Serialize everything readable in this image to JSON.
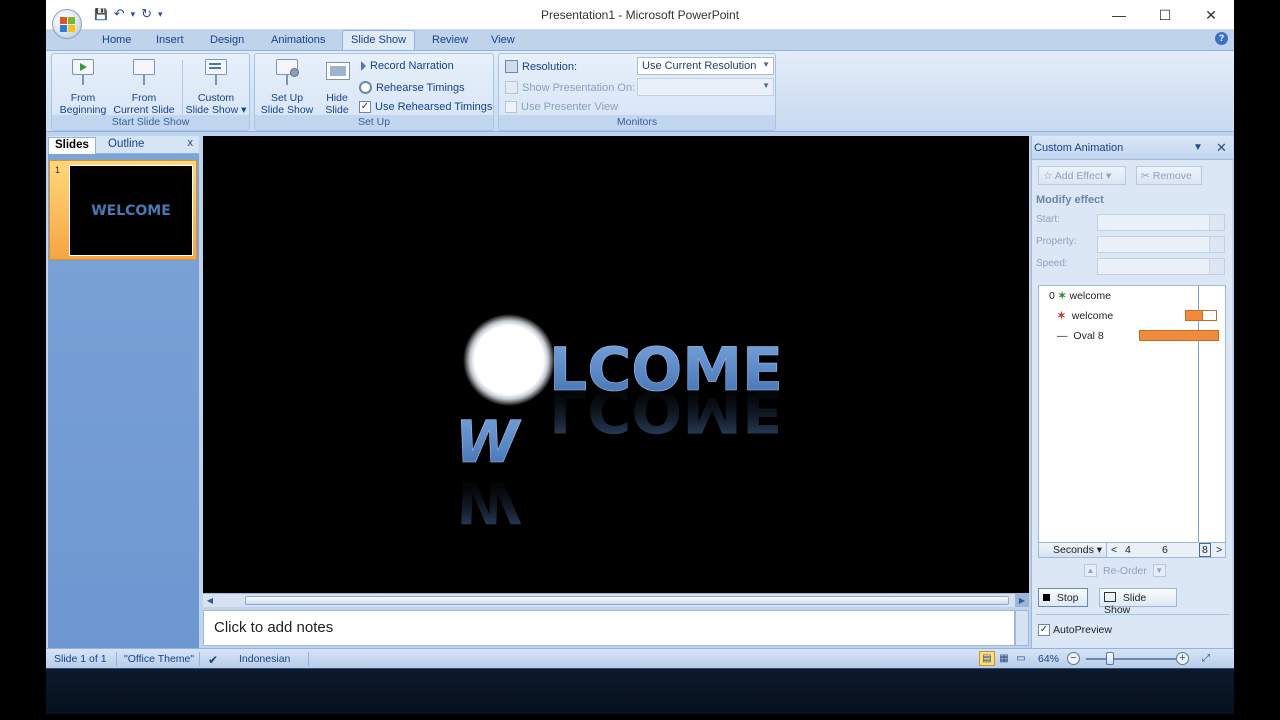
{
  "window": {
    "title": "Presentation1 - Microsoft PowerPoint",
    "minimize": "—",
    "maximize": "☐",
    "close": "✕"
  },
  "qat": {
    "save": "💾",
    "undo": "↶",
    "undo_drop": "▾",
    "redo": "↻",
    "customize": "▾"
  },
  "tabs": [
    "Home",
    "Insert",
    "Design",
    "Animations",
    "Slide Show",
    "Review",
    "View"
  ],
  "active_tab": "Slide Show",
  "ribbon": {
    "start_group": {
      "label": "Start Slide Show",
      "from_beginning": [
        "From",
        "Beginning"
      ],
      "from_current": [
        "From",
        "Current Slide"
      ],
      "custom": [
        "Custom",
        "Slide Show ▾"
      ]
    },
    "setup_group": {
      "label": "Set Up",
      "setup": [
        "Set Up",
        "Slide Show"
      ],
      "hide": [
        "Hide",
        "Slide"
      ],
      "record": "Record Narration",
      "rehearse": "Rehearse Timings",
      "use_rehearsed": "Use Rehearsed Timings",
      "use_rehearsed_checked": "✓"
    },
    "monitors_group": {
      "label": "Monitors",
      "resolution_label": "Resolution:",
      "resolution_value": "Use Current Resolution",
      "show_on_label": "Show Presentation On:",
      "show_on_value": "",
      "presenter_view": "Use Presenter View"
    }
  },
  "slides_pane": {
    "tab_slides": "Slides",
    "tab_outline": "Outline",
    "close": "x",
    "thumb_number": "1",
    "thumb_text": "WELCOME"
  },
  "slide": {
    "text_main": "LCOME",
    "text_w": "W"
  },
  "notes": {
    "placeholder": "Click to add notes"
  },
  "anim_pane": {
    "title": "Custom Animation",
    "dropdown": "▼",
    "close": "✕",
    "add_effect": "Add Effect ▾",
    "remove": "Remove",
    "modify_heading": "Modify effect",
    "start_label": "Start:",
    "property_label": "Property:",
    "speed_label": "Speed:",
    "items": [
      {
        "index": "0",
        "name": "welcome"
      },
      {
        "index": "",
        "name": "welcome"
      },
      {
        "index": "",
        "name": "Oval 8"
      }
    ],
    "timebar": {
      "units": "Seconds ▾",
      "ticks": [
        "4",
        "6",
        "8"
      ],
      "prev": "<",
      "next": ">"
    },
    "reorder": "Re-Order",
    "stop": "Stop",
    "slide_show": "Slide Show",
    "autopreview": "AutoPreview",
    "autopreview_checked": "✓"
  },
  "status": {
    "slide": "Slide 1 of 1",
    "theme": "\"Office Theme\"",
    "language": "Indonesian",
    "zoom": "64%",
    "zoom_minus": "−",
    "zoom_plus": "+"
  },
  "colors": {
    "accent": "#15428b",
    "ribbon": "#dfeaf7",
    "anim_bar": "#f08a3c",
    "slide_text": "#4a78b5"
  }
}
